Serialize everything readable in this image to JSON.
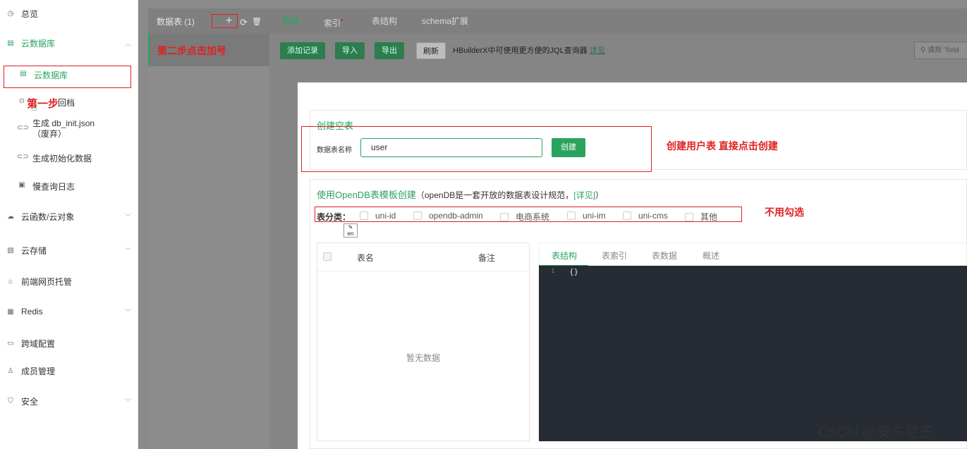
{
  "sidebar": {
    "overview": "总览",
    "cloud_db": "云数据库",
    "cloud_db_sub": "云数据库",
    "backup": "回档",
    "gen_init": "生成 db_init.json（废弃）",
    "gen_data": "生成初始化数据",
    "slow_log": "慢查询日志",
    "cloud_func": "云函数/云对象",
    "storage": "云存储",
    "hosting": "前端网页托管",
    "redis": "Redis",
    "cors": "跨域配置",
    "members": "成员管理",
    "security": "安全"
  },
  "annotations": {
    "step1": "第一步",
    "step2": "第二步点击加号",
    "create_note": "创建用户表 直接点击创建",
    "no_check": "不用勾选"
  },
  "toolbar": {
    "table_title": "数据表 (1)",
    "add_icon": "+",
    "refresh_icon": "⟳",
    "delete_icon": "🗑",
    "tabs": [
      "数据",
      "索引",
      "表结构",
      "schema扩展"
    ],
    "add_record": "添加记录",
    "import": "导入",
    "export": "导出",
    "refresh": "刷新",
    "hint": "HBuilderX中可使用更方便的JQL查询器",
    "hint_link": "详见",
    "search_placeholder": "请按 \"field"
  },
  "modal": {
    "empty_title": "创建空表",
    "name_label": "数据表名称",
    "name_value": "user",
    "create_btn": "创建",
    "opendb_title": "使用OpenDB表模板创建",
    "opendb_desc": "（openDB是一套开放的数据表设计规范，",
    "opendb_link": "[详见]",
    "opendb_end": "）",
    "category_label": "表分类：",
    "categories": [
      "uni-id",
      "opendb-admin",
      "电商系统",
      "uni-im",
      "uni-cms",
      "其他"
    ],
    "col_name": "表名",
    "col_note": "备注",
    "empty_text": "暂无数据",
    "code_tabs": [
      "表结构",
      "表索引",
      "表数据",
      "概述"
    ],
    "line_no": "1",
    "code": "{}"
  },
  "watermark": "CSDN @安东尼王"
}
